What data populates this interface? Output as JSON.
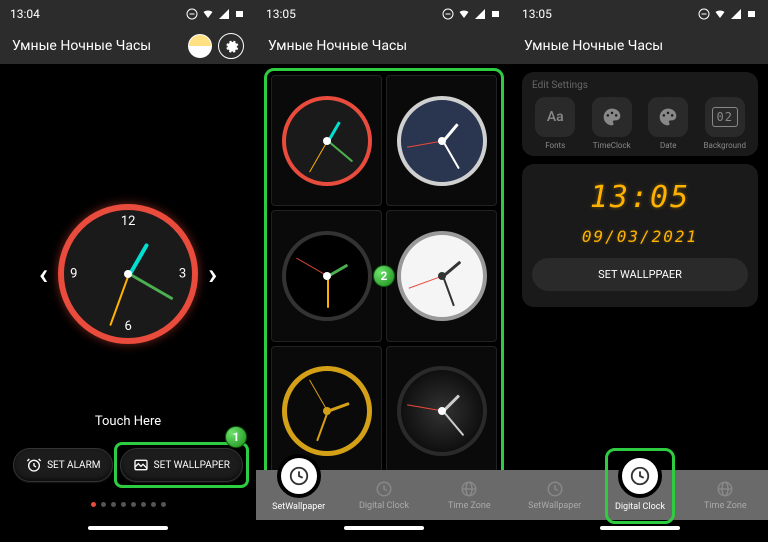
{
  "statusbar": {
    "time1": "13:04",
    "time2": "13:05",
    "time3": "13:05"
  },
  "header": {
    "title": "Умные Ночные Часы"
  },
  "phone1": {
    "touch_here": "Touch Here",
    "set_alarm": "SET ALARM",
    "set_wallpaper": "SET WALLPAPER",
    "clock_numbers": {
      "n12": "12",
      "n3": "3",
      "n6": "6",
      "n9": "9"
    },
    "step": "1"
  },
  "phone2": {
    "step": "2",
    "tabs": {
      "set_wallpaper": "SetWallpaper",
      "digital_clock": "Digital Clock",
      "time_zone": "Time Zone"
    }
  },
  "phone3": {
    "edit_settings": "Edit Settings",
    "chips": {
      "fonts": "Fonts",
      "timeclock": "TimeClock",
      "date": "Date",
      "background": "Background",
      "aa": "Aa",
      "bg": "02"
    },
    "digital_time": "13:05",
    "digital_date": "09/03/2021",
    "set_wallpaper_btn": "SET WALLPPAER",
    "tabs": {
      "set_wallpaper": "SetWallpaper",
      "digital_clock": "Digital Clock",
      "time_zone": "Time Zone"
    }
  }
}
